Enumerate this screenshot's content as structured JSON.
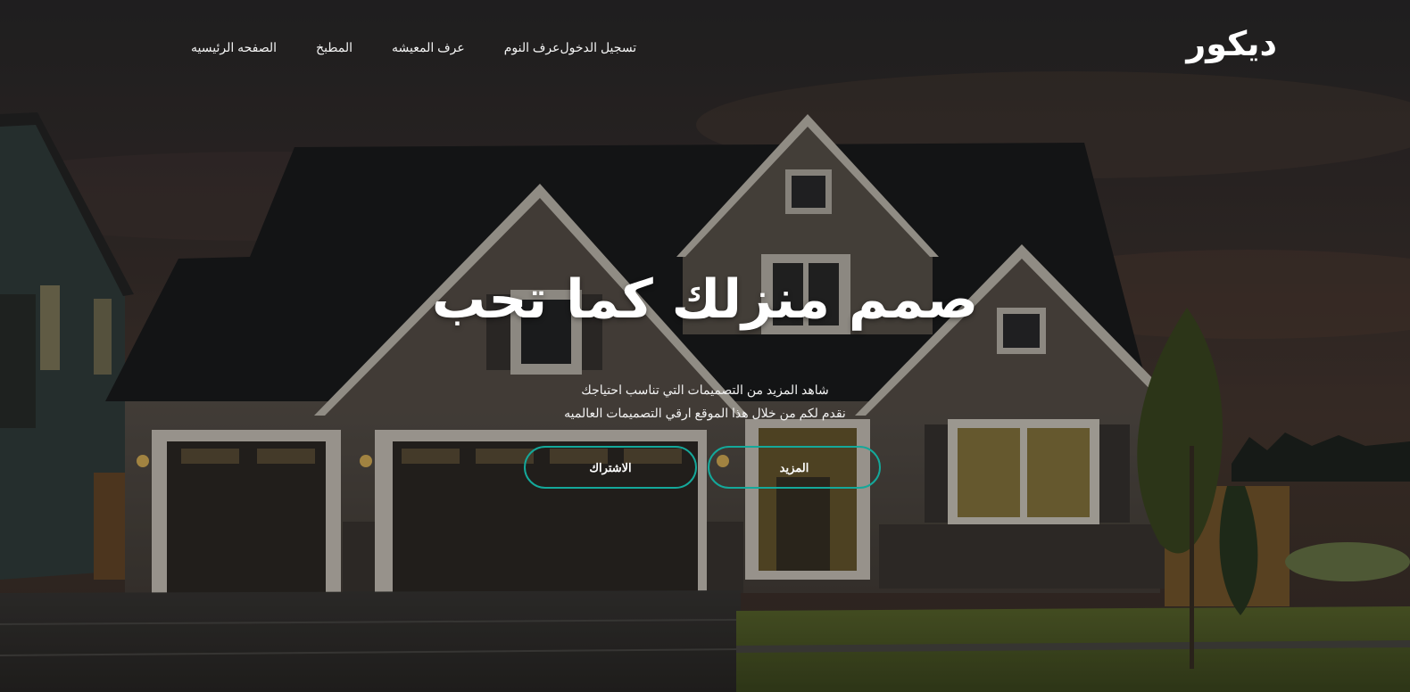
{
  "brand": {
    "name": "ديكور"
  },
  "nav": {
    "items": [
      {
        "label": "الصفحه الرئيسيه"
      },
      {
        "label": "المطبخ"
      },
      {
        "label": "عرف المعيشه"
      },
      {
        "label": "عرف النوم"
      },
      {
        "label": "تسجيل الدخول"
      }
    ]
  },
  "hero": {
    "headline": "صمم منزلك كما تحب",
    "subtitle_line1": "شاهد المزيد من التصميمات التي تناسب احتياجك",
    "subtitle_line2": "نقدم لكم من خلال هذا الموقع ارقي التصميمات العالميه",
    "more_button": "المزيد",
    "subscribe_button": "الاشتراك"
  },
  "colors": {
    "accent": "#14a89a",
    "text": "#ffffff"
  }
}
